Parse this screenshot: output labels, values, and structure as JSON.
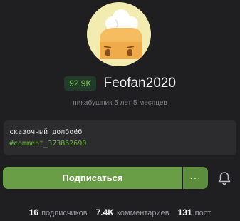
{
  "profile": {
    "rating": "92.9K",
    "username": "Feofan2020",
    "subtitle": "пикабушник 5 лет 5 месяцев",
    "avatar_icon": "chef-bread-avatar"
  },
  "bio": {
    "text": "сказочный долбоёб",
    "link": "#comment_373862690"
  },
  "actions": {
    "subscribe_label": "Подписаться",
    "more_label": "···",
    "bell_icon": "bell-icon"
  },
  "stats": {
    "subscribers_count": "16",
    "subscribers_label": "подписчиков",
    "comments_count": "7.4K",
    "comments_label": "комментариев",
    "posts_count": "131",
    "posts_label": "пост"
  },
  "colors": {
    "background": "#1f1f21",
    "accent": "#6a9e46",
    "link": "#6aad3d"
  }
}
